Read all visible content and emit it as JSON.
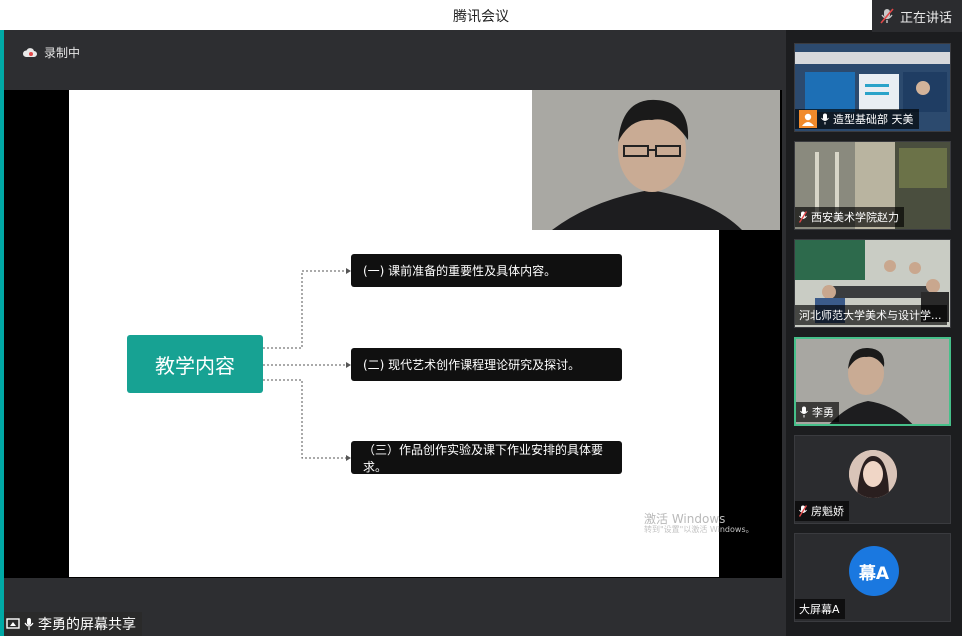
{
  "window": {
    "title": "腾讯会议"
  },
  "speaking": {
    "label": "正在讲话"
  },
  "recording": {
    "label": "录制中"
  },
  "slide": {
    "center_title": "教学内容",
    "items": [
      "(一) 课前准备的重要性及具体内容。",
      "(二) 现代艺术创作课程理论研究及探讨。",
      "（三）作品创作实验及课下作业安排的具体要求。"
    ],
    "watermark_line1": "激活 Windows",
    "watermark_line2": "转到\"设置\"以激活 Windows。"
  },
  "share": {
    "label": "李勇的屏幕共享"
  },
  "participants": [
    {
      "name": "造型基础部 天美",
      "muted": false
    },
    {
      "name": "西安美术学院赵力",
      "muted": true
    },
    {
      "name": "河北师范大学美术与设计学...",
      "muted": false
    },
    {
      "name": "李勇",
      "muted": false,
      "active": true
    },
    {
      "name": "房魁娇",
      "muted": true
    },
    {
      "name": "大屏幕A",
      "avatar_text": "幕A",
      "muted": false
    }
  ],
  "colors": {
    "accent": "#17a293",
    "active_border": "#46c08a",
    "avatar_blue": "#1a78e0"
  }
}
